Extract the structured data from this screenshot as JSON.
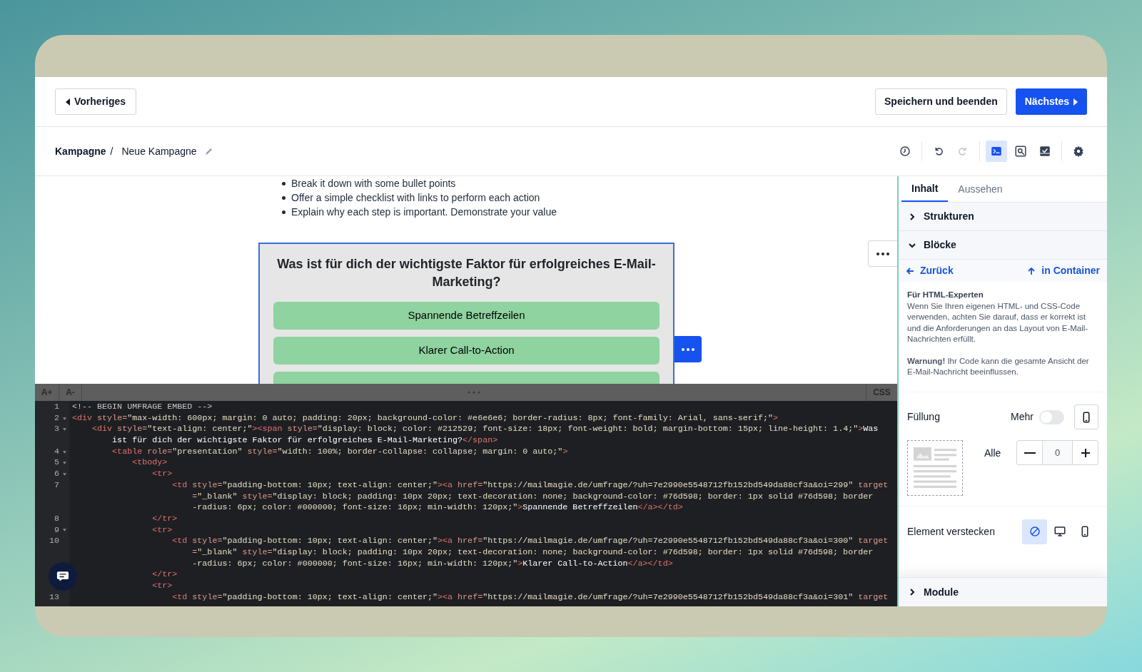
{
  "header": {
    "back_button": "Vorheriges",
    "save_button": "Speichern und beenden",
    "next_button": "Nächstes"
  },
  "breadcrumb": {
    "root": "Kampagne",
    "separator": "/",
    "name": "Neue Kampagne"
  },
  "toolbar": [
    [
      {
        "kind": "history",
        "selected": false,
        "disabled": false
      }
    ],
    [
      {
        "kind": "undo",
        "selected": false,
        "disabled": false
      },
      {
        "kind": "redo",
        "selected": false,
        "disabled": true
      }
    ],
    [
      {
        "kind": "code",
        "selected": true,
        "disabled": false
      },
      {
        "kind": "preview",
        "selected": false,
        "disabled": false
      },
      {
        "kind": "check",
        "selected": false,
        "disabled": false
      }
    ],
    [
      {
        "kind": "settings",
        "selected": false,
        "disabled": false
      }
    ]
  ],
  "canvas": {
    "bullets": [
      "Break it down with some bullet points",
      "Offer a simple checklist with links to perform each action",
      "Explain why each step is important. Demonstrate your value"
    ],
    "survey": {
      "question": "Was ist für dich der wichtigste Faktor für erfolgreiches E-Mail-Marketing?",
      "options": [
        "Spannende Betreffzeilen",
        "Klarer Call-to-Action"
      ]
    }
  },
  "code_editor": {
    "font_up": "A+",
    "font_down": "A-",
    "mode": "CSS",
    "lines": [
      {
        "number": "1",
        "fold": false,
        "segments": [
          {
            "kind": "comment",
            "text": "<!-- BEGIN UMFRAGE EMBED -->"
          }
        ]
      },
      {
        "number": "2",
        "fold": true,
        "segments": [
          {
            "kind": "tag",
            "text": "<div"
          },
          {
            "kind": "attr",
            "text": " style="
          },
          {
            "kind": "str",
            "text": "\"max-width: 600px; margin: 0 auto; padding: 20px; background-color: #e6e6e6; border-radius: 8px; font-family: Arial, sans-serif;\""
          },
          {
            "kind": "tag",
            "text": ">"
          }
        ]
      },
      {
        "number": "3",
        "fold": true,
        "segments": [
          {
            "kind": "tag",
            "text": "    <div"
          },
          {
            "kind": "attr",
            "text": " style="
          },
          {
            "kind": "str",
            "text": "\"text-align: center;\""
          },
          {
            "kind": "tag",
            "text": "><span"
          },
          {
            "kind": "attr",
            "text": " style="
          },
          {
            "kind": "str",
            "text": "\"display: block; color: #212529; font-size: 18px; font-weight: bold; margin-bottom: 15px; line-height: 1.4;\""
          },
          {
            "kind": "tag",
            "text": ">"
          },
          {
            "kind": "text",
            "text": "Was"
          }
        ]
      },
      {
        "fold": false,
        "segments": [
          {
            "kind": "text",
            "text": "        ist für dich der wichtigste Faktor für erfolgreiches E-Mail-Marketing?"
          },
          {
            "kind": "tag",
            "text": "</span>"
          }
        ]
      },
      {
        "number": "4",
        "fold": true,
        "segments": [
          {
            "kind": "tag",
            "text": "        <table"
          },
          {
            "kind": "attr",
            "text": " role="
          },
          {
            "kind": "str",
            "text": "\"presentation\""
          },
          {
            "kind": "attr",
            "text": " style="
          },
          {
            "kind": "str",
            "text": "\"width: 100%; border-collapse: collapse; margin: 0 auto;\""
          },
          {
            "kind": "tag",
            "text": ">"
          }
        ]
      },
      {
        "number": "5",
        "fold": true,
        "segments": [
          {
            "kind": "tag",
            "text": "            <tbody>"
          }
        ]
      },
      {
        "number": "6",
        "fold": true,
        "segments": [
          {
            "kind": "tag",
            "text": "                <tr>"
          }
        ]
      },
      {
        "number": "7",
        "fold": false,
        "segments": [
          {
            "kind": "tag",
            "text": "                    <td"
          },
          {
            "kind": "attr",
            "text": " style="
          },
          {
            "kind": "str",
            "text": "\"padding-bottom: 10px; text-align: center;\""
          },
          {
            "kind": "tag",
            "text": "><a"
          },
          {
            "kind": "attr",
            "text": " href="
          },
          {
            "kind": "str",
            "text": "\"https://mailmagie.de/umfrage/?uh=7e2990e5548712fb152bd549da88cf3a&oi=299\""
          },
          {
            "kind": "attr",
            "text": " target"
          }
        ]
      },
      {
        "fold": false,
        "segments": [
          {
            "kind": "attr",
            "text": "                        ="
          },
          {
            "kind": "str",
            "text": "\"_blank\""
          },
          {
            "kind": "attr",
            "text": " style="
          },
          {
            "kind": "str",
            "text": "\"display: block; padding: 10px 20px; text-decoration: none; background-color: #76d598; border: 1px solid #76d598; border"
          }
        ]
      },
      {
        "fold": false,
        "segments": [
          {
            "kind": "str",
            "text": "                        -radius: 6px; color: #000000; font-size: 16px; min-width: 120px;\""
          },
          {
            "kind": "tag",
            "text": ">"
          },
          {
            "kind": "text",
            "text": "Spannende Betreffzeilen"
          },
          {
            "kind": "tag",
            "text": "</a></td>"
          }
        ]
      },
      {
        "number": "8",
        "fold": false,
        "segments": [
          {
            "kind": "tag",
            "text": "                </tr>"
          }
        ]
      },
      {
        "number": "9",
        "fold": true,
        "segments": [
          {
            "kind": "tag",
            "text": "                <tr>"
          }
        ]
      },
      {
        "number": "10",
        "fold": false,
        "segments": [
          {
            "kind": "tag",
            "text": "                    <td"
          },
          {
            "kind": "attr",
            "text": " style="
          },
          {
            "kind": "str",
            "text": "\"padding-bottom: 10px; text-align: center;\""
          },
          {
            "kind": "tag",
            "text": "><a"
          },
          {
            "kind": "attr",
            "text": " href="
          },
          {
            "kind": "str",
            "text": "\"https://mailmagie.de/umfrage/?uh=7e2990e5548712fb152bd549da88cf3a&oi=300\""
          },
          {
            "kind": "attr",
            "text": " target"
          }
        ]
      },
      {
        "fold": false,
        "segments": [
          {
            "kind": "attr",
            "text": "                        ="
          },
          {
            "kind": "str",
            "text": "\"_blank\""
          },
          {
            "kind": "attr",
            "text": " style="
          },
          {
            "kind": "str",
            "text": "\"display: block; padding: 10px 20px; text-decoration: none; background-color: #76d598; border: 1px solid #76d598; border"
          }
        ]
      },
      {
        "fold": false,
        "segments": [
          {
            "kind": "str",
            "text": "                        -radius: 6px; color: #000000; font-size: 16px; min-width: 120px;\""
          },
          {
            "kind": "tag",
            "text": ">"
          },
          {
            "kind": "text",
            "text": "Klarer Call-to-Action"
          },
          {
            "kind": "tag",
            "text": "</a></td>"
          }
        ]
      },
      {
        "fold": false,
        "segments": [
          {
            "kind": "tag",
            "text": "                </tr>"
          }
        ]
      },
      {
        "fold": false,
        "segments": [
          {
            "kind": "tag",
            "text": "                <tr>"
          }
        ]
      },
      {
        "number": "13",
        "fold": false,
        "segments": [
          {
            "kind": "tag",
            "text": "                    <td"
          },
          {
            "kind": "attr",
            "text": " style="
          },
          {
            "kind": "str",
            "text": "\"padding-bottom: 10px; text-align: center;\""
          },
          {
            "kind": "tag",
            "text": "><a"
          },
          {
            "kind": "attr",
            "text": " href="
          },
          {
            "kind": "str",
            "text": "\"https://mailmagie.de/umfrage/?uh=7e2990e5548712fb152bd549da88cf3a&oi=301\""
          },
          {
            "kind": "attr",
            "text": " target"
          }
        ]
      }
    ]
  },
  "panel": {
    "tabs": [
      {
        "label": "Inhalt",
        "selected": true
      },
      {
        "label": "Aussehen",
        "selected": false
      }
    ],
    "sections": [
      {
        "label": "Strukturen",
        "expanded": false
      },
      {
        "label": "Blöcke",
        "expanded": true
      }
    ],
    "nav": {
      "back": "Zurück",
      "up": "in Container"
    },
    "info": {
      "title": "Für HTML-Experten",
      "body": "Wenn Sie Ihren eigenen HTML- und CSS-Code verwenden, achten Sie darauf, dass er korrekt ist und die Anforderungen an das Layout von E-Mail-Nachrichten erfüllt.",
      "warning": "**Warnung!** Ihr Code kann die gesamte Ansicht der E-Mail-Nachricht beeinflussen."
    },
    "padding": {
      "label": "Füllung",
      "more_label": "Mehr",
      "more_on": false,
      "all_label": "Alle",
      "value": "0"
    },
    "hide": {
      "label": "Element verstecken",
      "options": [
        {
          "kind": "none",
          "selected": true
        },
        {
          "kind": "desktop",
          "selected": false
        },
        {
          "kind": "mobile",
          "selected": false
        }
      ]
    },
    "footer_section": {
      "label": "Module",
      "expanded": false
    }
  }
}
